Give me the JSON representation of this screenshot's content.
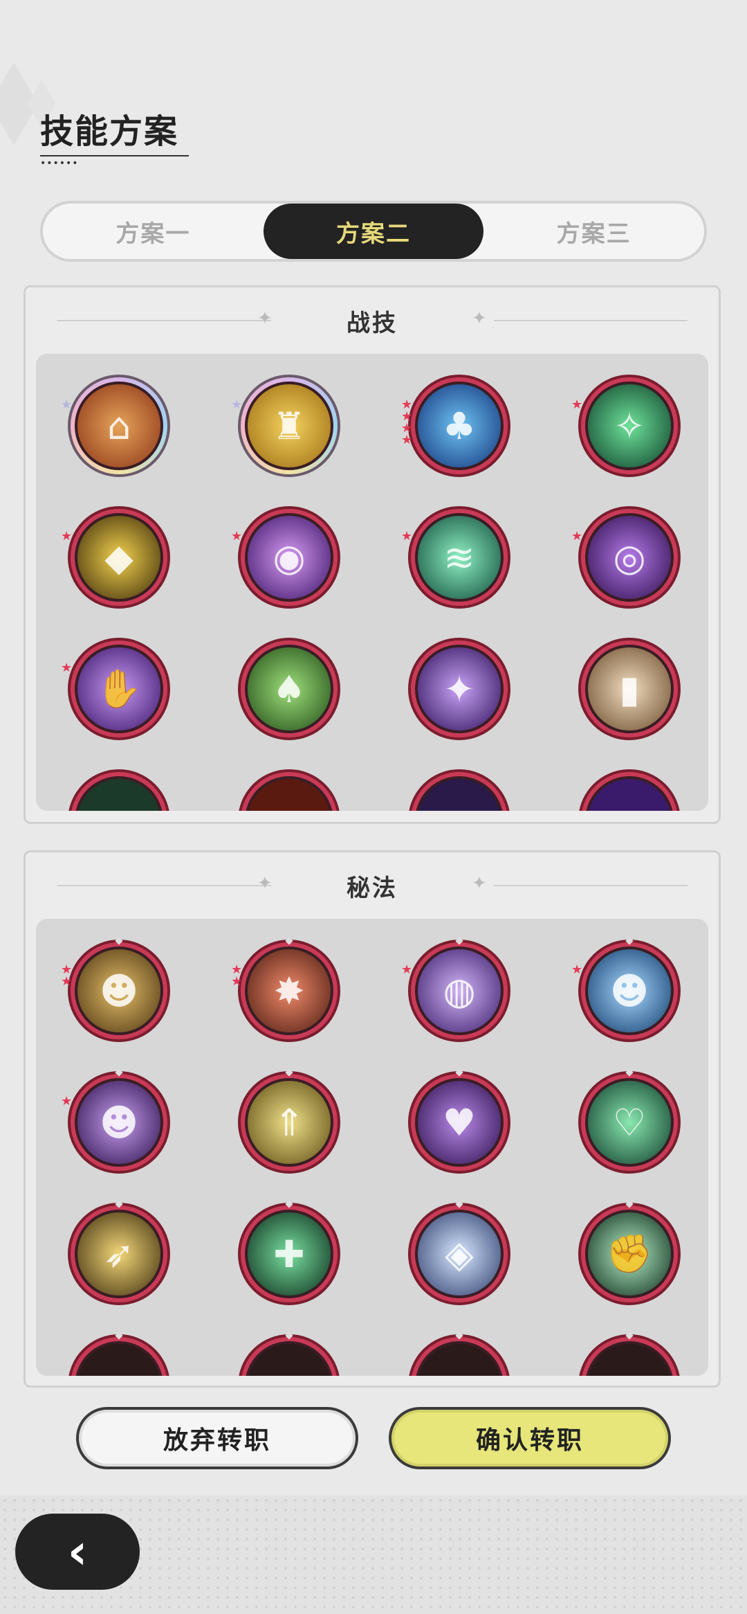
{
  "header": {
    "title": "技能方案"
  },
  "tabs": [
    {
      "label": "方案一",
      "active": false
    },
    {
      "label": "方案二",
      "active": true
    },
    {
      "label": "方案三",
      "active": false
    }
  ],
  "sections": {
    "combat": {
      "title": "战技"
    },
    "secret": {
      "title": "秘法"
    }
  },
  "buttons": {
    "cancel_label": "放弃转职",
    "confirm_label": "确认转职"
  },
  "colors": {
    "ring": "#c93a57",
    "active_tab_bg": "#232323",
    "active_tab_text": "#e5d97a",
    "confirm_bg": "#e6e67a"
  }
}
